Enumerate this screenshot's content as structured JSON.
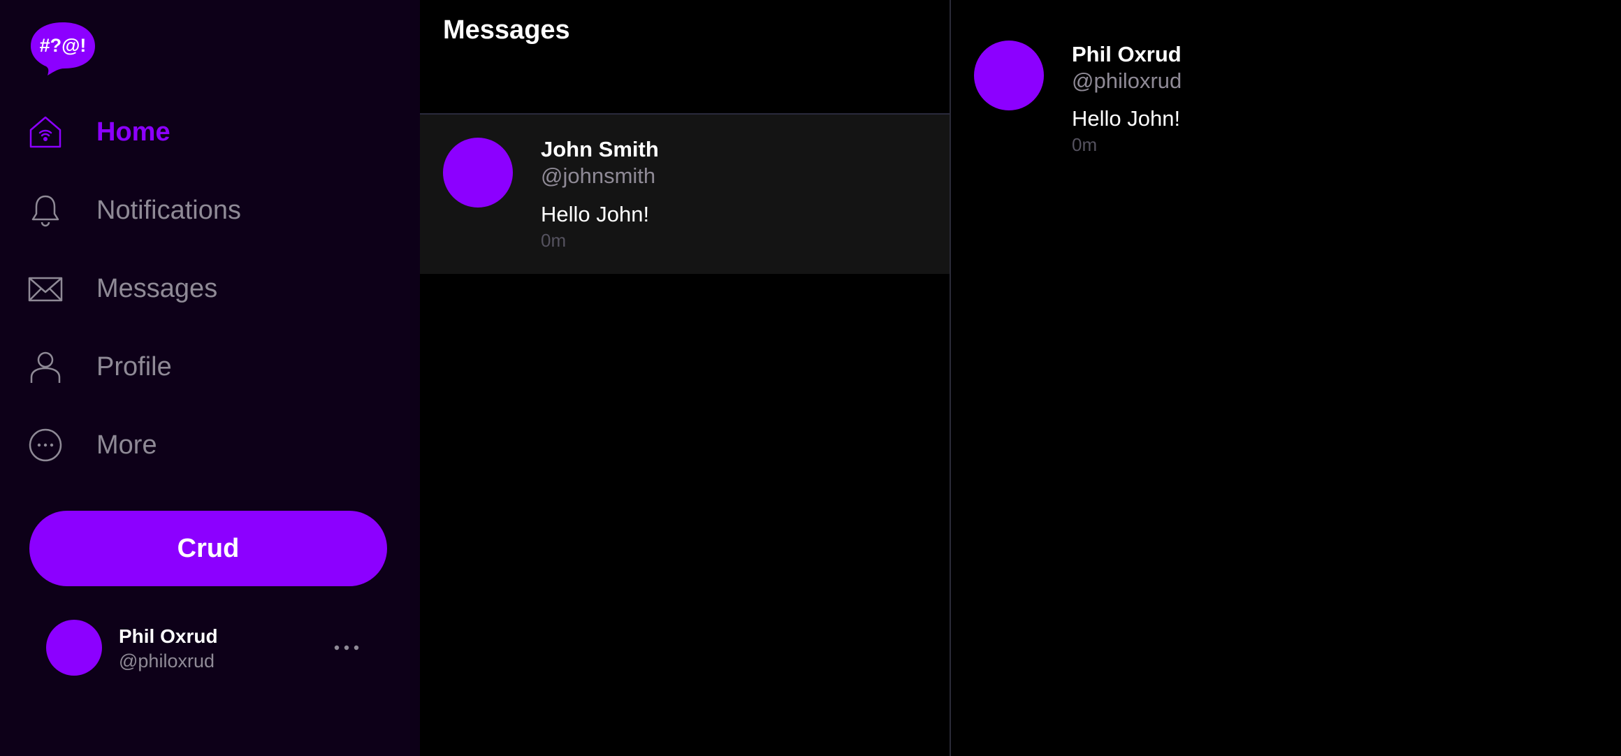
{
  "colors": {
    "accent": "#8c00ff",
    "sidebar_bg": "#0d0018",
    "muted": "#8f8a96"
  },
  "logo": {
    "text": "#?@!",
    "icon": "speech-bubble-logo"
  },
  "sidebar": {
    "items": [
      {
        "label": "Home",
        "icon": "home-icon",
        "active": true
      },
      {
        "label": "Notifications",
        "icon": "bell-icon",
        "active": false
      },
      {
        "label": "Messages",
        "icon": "envelope-icon",
        "active": false
      },
      {
        "label": "Profile",
        "icon": "person-icon",
        "active": false
      },
      {
        "label": "More",
        "icon": "more-circle-icon",
        "active": false
      }
    ],
    "crud_button": "Crud",
    "account": {
      "name": "Phil Oxrud",
      "handle": "@philoxrud",
      "menu_icon": "ellipsis-icon"
    }
  },
  "messages": {
    "title": "Messages",
    "conversations": [
      {
        "name": "John Smith",
        "handle": "@johnsmith",
        "last_message": "Hello John!",
        "time": "0m"
      }
    ]
  },
  "detail": {
    "name": "Phil Oxrud",
    "handle": "@philoxrud",
    "message": "Hello John!",
    "time": "0m"
  }
}
